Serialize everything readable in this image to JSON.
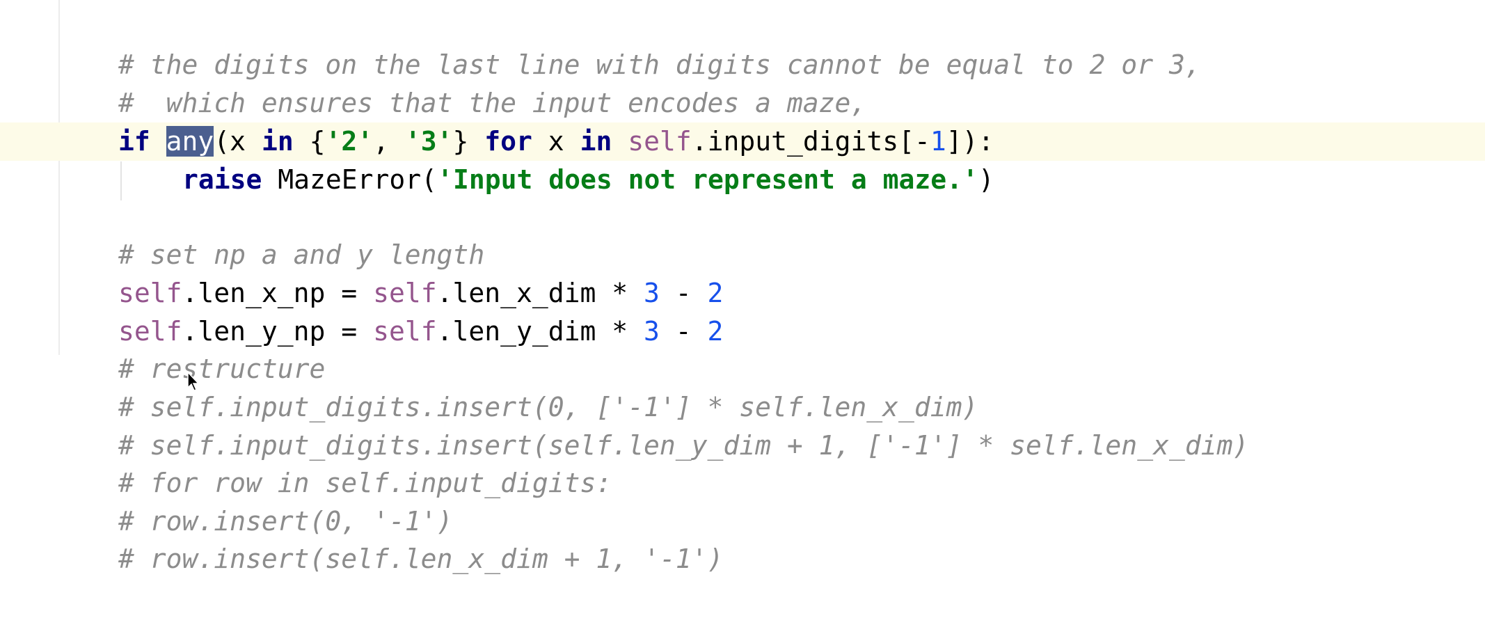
{
  "editor": {
    "lines": [
      {
        "text": "# the digits on the last line with digits cannot be equal to 2 or 3,"
      },
      {
        "text": "#  which ensures that the input encodes a maze,"
      },
      {
        "parts": [
          "if",
          " ",
          "any",
          "(x ",
          "in",
          " {",
          "'2'",
          ", ",
          "'3'",
          "} ",
          "for",
          " x ",
          "in",
          " ",
          "self",
          ".input_digits[-",
          "1",
          "]):"
        ]
      },
      {
        "parts": [
          "raise",
          " MazeError(",
          "'Input does not represent a maze.'",
          ")"
        ]
      },
      {
        "text": "# set np a and y length"
      },
      {
        "parts": [
          "self",
          ".len_x_np = ",
          "self",
          ".len_x_dim * ",
          "3",
          " - ",
          "2"
        ]
      },
      {
        "parts": [
          "self",
          ".len_y_np = ",
          "self",
          ".len_y_dim * ",
          "3",
          " - ",
          "2"
        ]
      },
      {
        "text": "# restructure"
      },
      {
        "text": "# self.input_digits.insert(0, ['-1'] * self.len_x_dim)"
      },
      {
        "text": "# self.input_digits.insert(self.len_y_dim + 1, ['-1'] * self.len_x_dim)"
      },
      {
        "text": "# for row in self.input_digits:"
      },
      {
        "text": "# row.insert(0, '-1')"
      },
      {
        "text": "# row.insert(self.len_x_dim + 1, '-1')"
      }
    ],
    "selected_word": "any",
    "icons": {
      "mouse_cursor": "mouse-pointer-icon"
    }
  }
}
